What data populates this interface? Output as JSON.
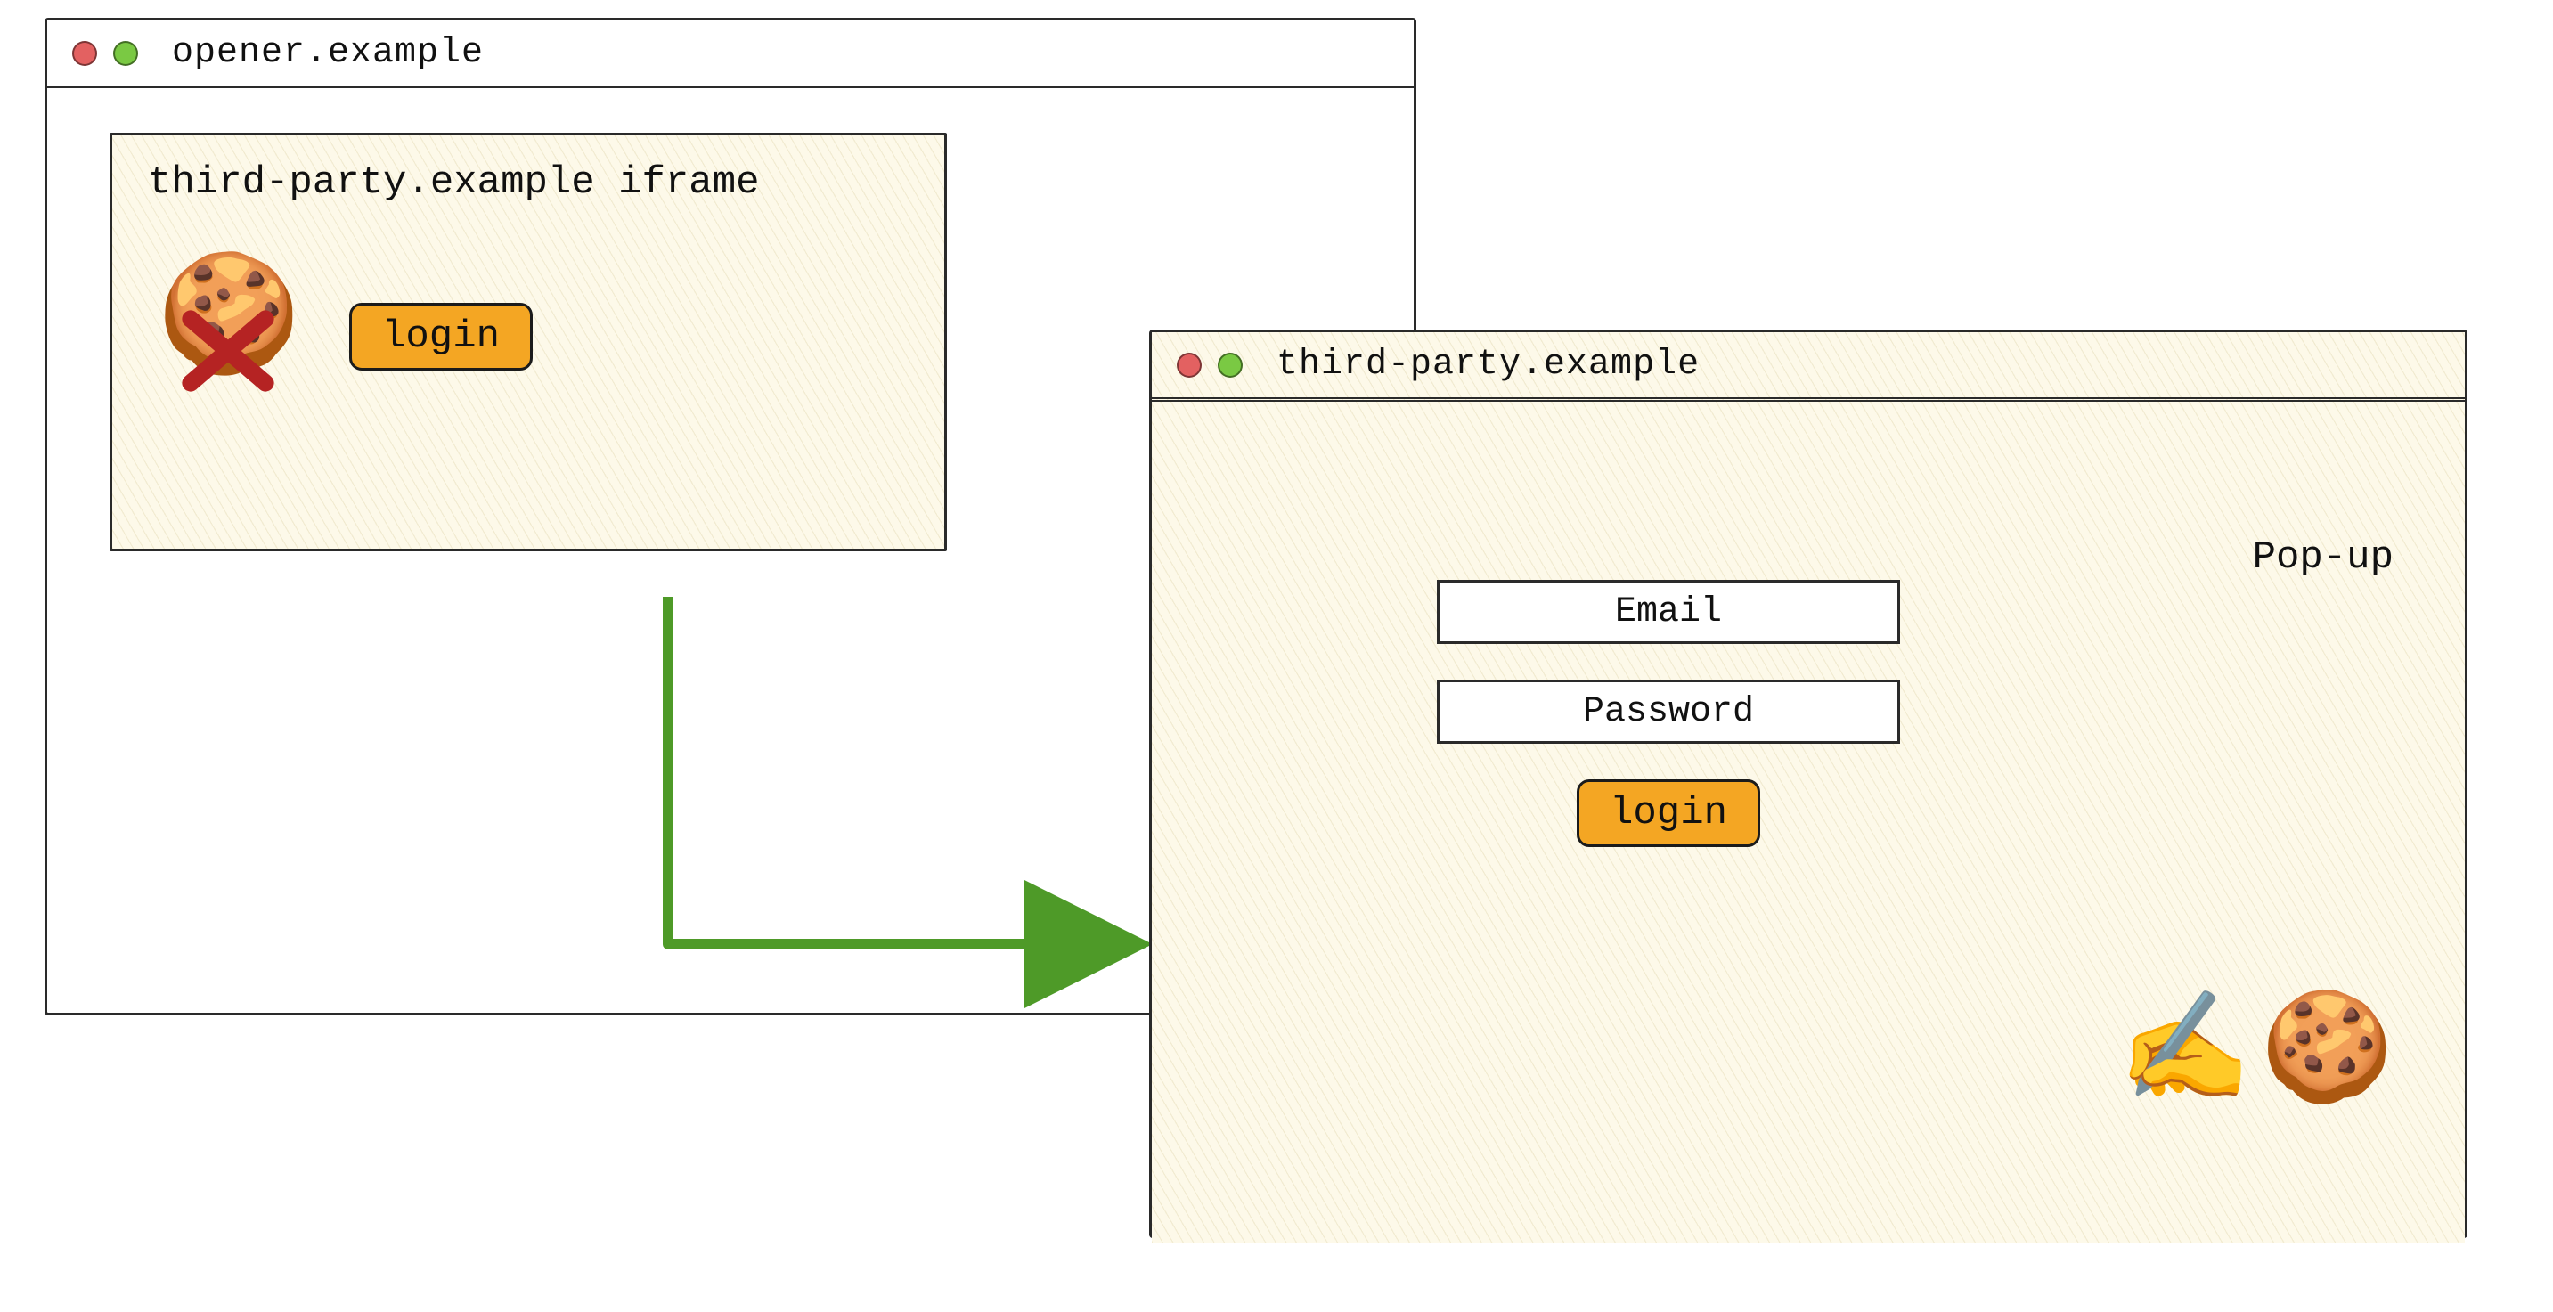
{
  "opener": {
    "title": "opener.example",
    "iframe": {
      "label": "third-party.example iframe",
      "login_label": "login",
      "cookie_icon": "🍪"
    }
  },
  "popup": {
    "title": "third-party.example",
    "label": "Pop-up",
    "form": {
      "email_label": "Email",
      "password_label": "Password",
      "login_label": "login"
    },
    "icons": {
      "writing": "✍️",
      "cookie": "🍪"
    }
  },
  "colors": {
    "accent": "#f4a623",
    "arrow": "#4e9a28",
    "x": "#b52323"
  }
}
